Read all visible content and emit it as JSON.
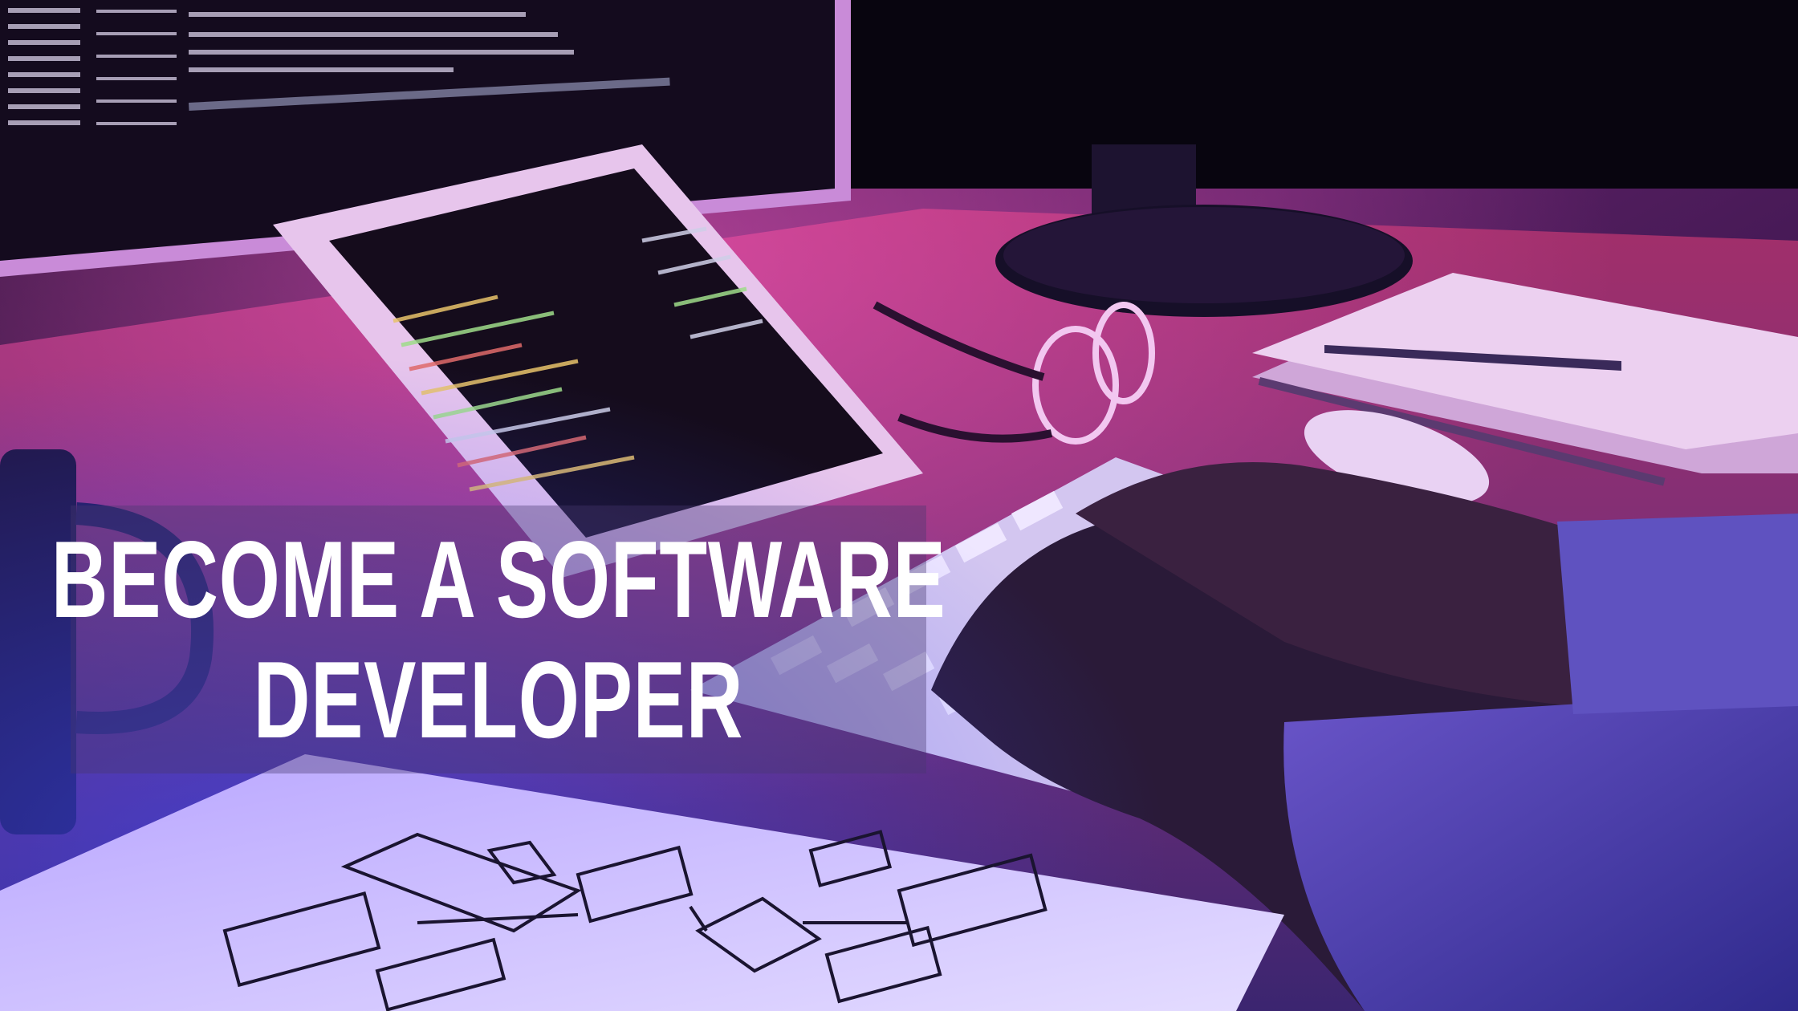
{
  "headline": {
    "line1": "BECOME A SOFTWARE",
    "line2": "DEVELOPER"
  },
  "palette": {
    "magenta": "#c43a8e",
    "violet": "#6b4cc8",
    "blue": "#2a3de0",
    "dark": "#0b0716"
  },
  "scene_objects": [
    "monitor-with-terminal",
    "tablet-with-code",
    "eyeglasses",
    "spiral-notebook",
    "pen",
    "mouse",
    "keyboard",
    "typing-hands",
    "coffee-mug",
    "flowchart-paper"
  ]
}
